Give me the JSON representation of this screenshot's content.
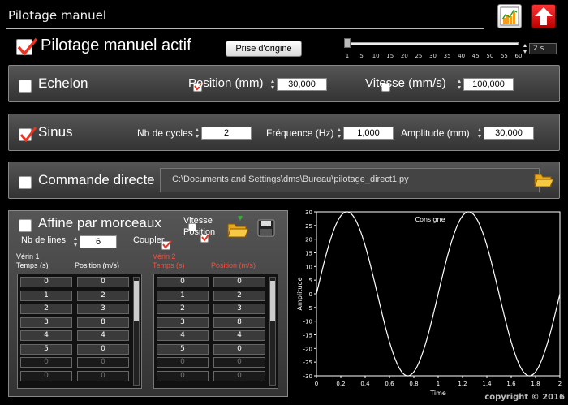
{
  "window": {
    "title": "Pilotage manuel"
  },
  "header": {
    "actif_label": "Pilotage manuel actif",
    "actif_checked": true,
    "origine_button": "Prise d'origine",
    "slider": {
      "ticks": [
        "1",
        "5",
        "10",
        "15",
        "20",
        "25",
        "30",
        "35",
        "40",
        "45",
        "50",
        "55",
        "60"
      ],
      "value": 1,
      "duration": "2 s"
    }
  },
  "echelon": {
    "title": "Echelon",
    "checked": false,
    "position_label": "Position (mm)",
    "position_checked": true,
    "position_value": "30,000",
    "vitesse_label": "Vitesse (mm/s)",
    "vitesse_checked": false,
    "vitesse_value": "100,000"
  },
  "sinus": {
    "title": "Sinus",
    "checked": true,
    "cycles_label": "Nb de cycles",
    "cycles_value": "2",
    "freq_label": "Fréquence (Hz)",
    "freq_value": "1,000",
    "ampl_label": "Amplitude (mm)",
    "ampl_value": "30,000"
  },
  "commande": {
    "title": "Commande directe",
    "checked": false,
    "path": "C:\\Documents and Settings\\dms\\Bureau\\pilotage_direct1.py"
  },
  "affine": {
    "title": "Affine par morceaux",
    "checked": false,
    "vitesse_label": "Vitesse",
    "vitesse_checked": false,
    "position_label": "Position",
    "position_checked": true,
    "lines_label": "Nb de lines",
    "lines_value": "6",
    "coupler_label": "Coupler",
    "coupler_checked": true,
    "verin1": {
      "title": "Vérin 1",
      "col_temps": "Temps (s)",
      "col_pos": "Position (m/s)",
      "rows": [
        [
          "0",
          "0"
        ],
        [
          "1",
          "2"
        ],
        [
          "2",
          "3"
        ],
        [
          "3",
          "8"
        ],
        [
          "4",
          "4"
        ],
        [
          "5",
          "0"
        ],
        [
          "0",
          "0"
        ],
        [
          "0",
          "0"
        ]
      ]
    },
    "verin2": {
      "title": "Vérin 2",
      "col_temps": "Temps (s)",
      "col_pos": "Position (m/s)",
      "rows": [
        [
          "0",
          "0"
        ],
        [
          "1",
          "2"
        ],
        [
          "2",
          "3"
        ],
        [
          "3",
          "8"
        ],
        [
          "4",
          "4"
        ],
        [
          "5",
          "0"
        ],
        [
          "0",
          "0"
        ],
        [
          "0",
          "0"
        ]
      ]
    }
  },
  "chart_data": {
    "type": "line",
    "title": "Consigne",
    "xlabel": "Time",
    "ylabel": "Amplitude",
    "xlim": [
      0,
      2
    ],
    "ylim": [
      -30,
      30
    ],
    "x_ticks": [
      "0",
      "0,2",
      "0,4",
      "0,6",
      "0,8",
      "1",
      "1,2",
      "1,4",
      "1,6",
      "1,8",
      "2"
    ],
    "y_ticks": [
      "30",
      "25",
      "20",
      "15",
      "10",
      "5",
      "0",
      "-5",
      "-10",
      "-15",
      "-20",
      "-25",
      "-30"
    ],
    "series": [
      {
        "function": "30*sin(2*pi*1*t)",
        "amplitude": 30,
        "frequency": 1,
        "cycles": 2,
        "color": "#ffffff"
      }
    ]
  },
  "footer": {
    "copyright": "copyright © 2016"
  },
  "colors": {
    "accent_red": "#ff4b3a",
    "background": "#000000"
  }
}
